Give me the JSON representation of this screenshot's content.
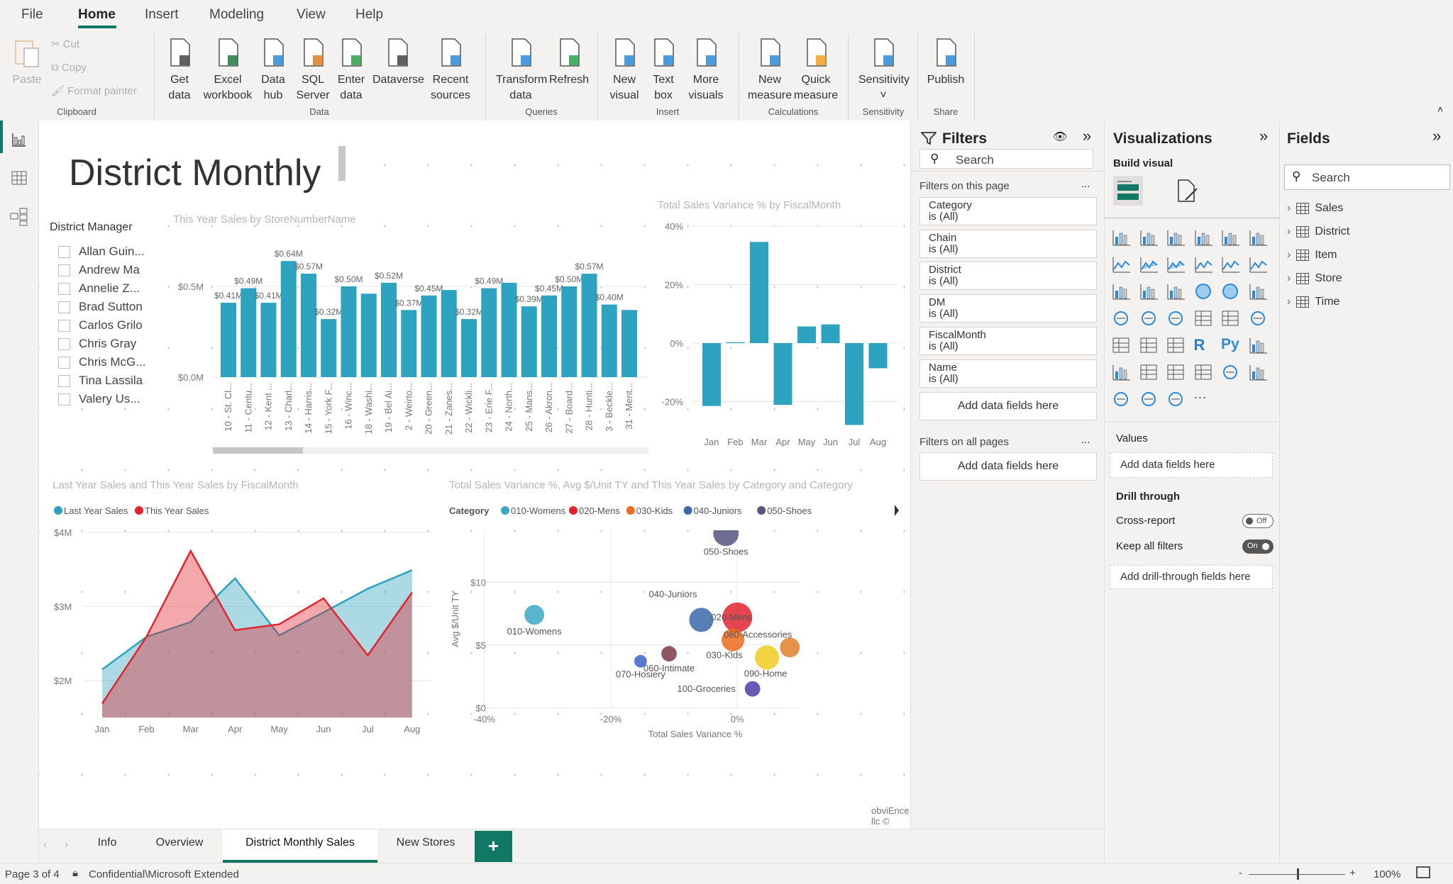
{
  "menu": {
    "tabs": [
      "File",
      "Home",
      "Insert",
      "Modeling",
      "View",
      "Help"
    ],
    "active": "Home"
  },
  "ribbon": {
    "clipboard": {
      "paste": "Paste",
      "cut": "Cut",
      "copy": "Copy",
      "format_painter": "Format painter",
      "group": "Clipboard"
    },
    "data": {
      "get_data": [
        "Get",
        "data"
      ],
      "excel": [
        "Excel",
        "workbook"
      ],
      "data_hub": [
        "Data",
        "hub"
      ],
      "sql": [
        "SQL",
        "Server"
      ],
      "enter": [
        "Enter",
        "data"
      ],
      "dataverse": [
        "Dataverse",
        ""
      ],
      "recent": [
        "Recent",
        "sources"
      ],
      "group": "Data"
    },
    "queries": {
      "transform": [
        "Transform",
        "data"
      ],
      "refresh": [
        "Refresh",
        ""
      ],
      "group": "Queries"
    },
    "insert": {
      "new_visual": [
        "New",
        "visual"
      ],
      "text_box": [
        "Text",
        "box"
      ],
      "more_visuals": [
        "More",
        "visuals"
      ],
      "group": "Insert"
    },
    "calculations": {
      "new_measure": [
        "New",
        "measure"
      ],
      "quick_measure": [
        "Quick",
        "measure"
      ],
      "group": "Calculations"
    },
    "sensitivity": {
      "label": [
        "Sensitivity",
        "˅"
      ],
      "group": "Sensitivity"
    },
    "share": {
      "publish": [
        "Publish",
        ""
      ],
      "group": "Share"
    }
  },
  "report": {
    "title": "District Monthly",
    "slicer": {
      "title": "District Manager",
      "items": [
        "Allan Guin...",
        "Andrew Ma",
        "Annelie Z...",
        "Brad Sutton",
        "Carlos Grilo",
        "Chris Gray",
        "Chris McG...",
        "Tina Lassila",
        "Valery Us..."
      ]
    },
    "watermark": "obviEnce llc ©"
  },
  "chart_data": [
    {
      "type": "bar",
      "title": "This Year Sales by StoreNumberName",
      "ylim": [
        0,
        0.65
      ],
      "yticks": [
        "$0.0M",
        "$0.5M"
      ],
      "ytick_values": [
        0,
        0.5
      ],
      "unit": "$M",
      "categories": [
        "10 - St. Cl...",
        "11 - Centu...",
        "12 - Kent ...",
        "13 - Charl...",
        "14 - Harris...",
        "15 - York F...",
        "16 - Winc...",
        "18 - Washi...",
        "19 - Bel Ai...",
        "2 - Weirto...",
        "20 - Green...",
        "21 - Zanes...",
        "22 - Wickli...",
        "23 - Erie F...",
        "24 - North...",
        "25 - Mans...",
        "26 - Akron...",
        "27 - Board...",
        "28 - Hunti...",
        "3 - Beckle...",
        "31 - Ment..."
      ],
      "values": [
        0.41,
        0.49,
        0.41,
        0.64,
        0.57,
        0.32,
        0.5,
        0.46,
        0.52,
        0.37,
        0.45,
        0.48,
        0.32,
        0.49,
        0.52,
        0.39,
        0.45,
        0.5,
        0.57,
        0.4,
        0.37
      ],
      "data_labels": [
        "$0.41M",
        "$0.49M",
        "$0.41M",
        "$0.64M",
        "$0.57M",
        "$0.32M",
        "$0.50M",
        null,
        "$0.52M",
        "$0.37M",
        "$0.45M",
        null,
        "$0.32M",
        "$0.49M",
        null,
        "$0.39M",
        "$0.45M",
        "$0.50M",
        "$0.57M",
        "$0.40M",
        null
      ],
      "color": "#2ea3bf",
      "scroll_position": 0.0
    },
    {
      "type": "bar",
      "title": "Total Sales Variance % by FiscalMonth",
      "ylim": [
        -28,
        40
      ],
      "yticks": [
        "40%",
        "20%",
        "0%",
        "-20%"
      ],
      "ytick_values": [
        40,
        20,
        0,
        -20
      ],
      "categories": [
        "Jan",
        "Feb",
        "Mar",
        "Apr",
        "May",
        "Jun",
        "Jul",
        "Aug"
      ],
      "values": [
        -21.5,
        0.3,
        34.6,
        -21.1,
        5.7,
        6.4,
        -28,
        -8.6
      ],
      "color": "#2ea3bf"
    },
    {
      "type": "area",
      "title": "Last Year Sales and This Year Sales by FiscalMonth",
      "ylim": [
        1.5,
        4
      ],
      "yticks": [
        "$2M",
        "$3M",
        "$4M"
      ],
      "ytick_values": [
        2,
        3,
        4
      ],
      "categories": [
        "Jan",
        "Feb",
        "Mar",
        "Apr",
        "May",
        "Jun",
        "Jul",
        "Aug"
      ],
      "series": [
        {
          "name": "Last Year Sales",
          "color": "#2ea3bf",
          "values": [
            2.15,
            2.59,
            2.79,
            3.38,
            2.61,
            2.92,
            3.24,
            3.49
          ]
        },
        {
          "name": "This Year Sales",
          "color": "#e0252f",
          "values": [
            1.69,
            2.59,
            3.75,
            2.68,
            2.76,
            3.11,
            2.34,
            3.19
          ]
        }
      ],
      "legend": "top-left"
    },
    {
      "type": "scatter",
      "title": "Total Sales Variance %, Avg $/Unit TY and This Year Sales by Category and Category",
      "xlabel": "Total Sales Variance %",
      "ylabel": "Avg $/Unit TY",
      "xlim": [
        -40,
        10
      ],
      "ylim": [
        0,
        14.1
      ],
      "xticks": [
        "-40%",
        "-20%",
        "0%"
      ],
      "xtick_values": [
        -40,
        -20,
        0
      ],
      "yticks": [
        "$0",
        "$5",
        "$10"
      ],
      "ytick_values": [
        0,
        5,
        10
      ],
      "legend_title": "Category",
      "legend": [
        "010-Womens",
        "020-Mens",
        "030-Kids",
        "040-Juniors",
        "050-Shoes"
      ],
      "points": [
        {
          "name": "010-Womens",
          "x": -32.1,
          "y": 7.4,
          "sales_rel": 0.44,
          "color": "#3aa9c2"
        },
        {
          "name": "050-Shoes",
          "x": -1.8,
          "y": 13.9,
          "sales_rel": 0.73,
          "color": "#555580"
        },
        {
          "name": "040-Juniors",
          "x": -5.7,
          "y": 7.0,
          "sales_rel": 0.66,
          "color": "#3b68a8"
        },
        {
          "name": "020-Mens",
          "x": 0.0,
          "y": 7.2,
          "sales_rel": 1.0,
          "color": "#e0252f"
        },
        {
          "name": "030-Kids",
          "x": -0.7,
          "y": 5.4,
          "sales_rel": 0.58,
          "color": "#ee6a1f"
        },
        {
          "name": "080-Accessories",
          "x": 8.3,
          "y": 4.8,
          "sales_rel": 0.44,
          "color": "#e07f2a"
        },
        {
          "name": "090-Home",
          "x": 4.7,
          "y": 4.0,
          "sales_rel": 0.66,
          "color": "#f0cb20"
        },
        {
          "name": "100-Groceries",
          "x": 2.4,
          "y": 1.5,
          "sales_rel": 0.27,
          "color": "#4b3fa8"
        },
        {
          "name": "060-Intimate",
          "x": -10.8,
          "y": 4.3,
          "sales_rel": 0.27,
          "color": "#7d3a47"
        },
        {
          "name": "070-Hosiery",
          "x": -15.3,
          "y": 3.7,
          "sales_rel": 0.18,
          "color": "#3a64c8"
        }
      ]
    }
  ],
  "filters": {
    "title": "Filters",
    "search_placeholder": "Search",
    "this_page": "Filters on this page",
    "all_pages": "Filters on all pages",
    "more": "...",
    "cards": [
      {
        "field": "Category",
        "state": "is (All)"
      },
      {
        "field": "Chain",
        "state": "is (All)"
      },
      {
        "field": "District",
        "state": "is (All)"
      },
      {
        "field": "DM",
        "state": "is (All)"
      },
      {
        "field": "FiscalMonth",
        "state": "is (All)"
      },
      {
        "field": "Name",
        "state": "is (All)"
      }
    ],
    "add_fields": "Add data fields here"
  },
  "visualizations": {
    "title": "Visualizations",
    "build_visual": "Build visual",
    "values": "Values",
    "add_fields": "Add data fields here",
    "drill_through": "Drill through",
    "cross_report": "Cross-report",
    "cross_report_state": "Off",
    "keep_filters": "Keep all filters",
    "keep_filters_state": "On",
    "add_drill": "Add drill-through fields here",
    "icons": [
      "stacked-bar",
      "stacked-column",
      "clustered-bar",
      "clustered-column",
      "100-stacked-bar",
      "100-stacked-column",
      "line",
      "area",
      "stacked-area",
      "line-clustered-column",
      "line-stacked-column",
      "ribbon",
      "waterfall",
      "funnel",
      "scatter",
      "pie",
      "donut",
      "treemap",
      "map",
      "filled-map",
      "gauge",
      "card",
      "multi-row-card",
      "kpi",
      "slicer",
      "table",
      "matrix",
      "r-visual",
      "python-visual",
      "key-influencers",
      "decomposition-tree",
      "qa",
      "narrative",
      "paginated",
      "trophy",
      "power-apps-report",
      "azure-map",
      "power-apps",
      "power-automate",
      "more"
    ]
  },
  "fields": {
    "title": "Fields",
    "search_placeholder": "Search",
    "tables": [
      "Sales",
      "District",
      "Item",
      "Store",
      "Time"
    ]
  },
  "pages": {
    "tabs": [
      "Info",
      "Overview",
      "District Monthly Sales",
      "New Stores"
    ],
    "active": "District Monthly Sales",
    "add": "+"
  },
  "status": {
    "page": "Page 3 of 4",
    "sensitivity": "Confidential\\Microsoft Extended",
    "zoom": "100%",
    "zoom_level": 0.5
  },
  "colors": {
    "accent": "#117865",
    "bar": "#2ea3bf"
  }
}
